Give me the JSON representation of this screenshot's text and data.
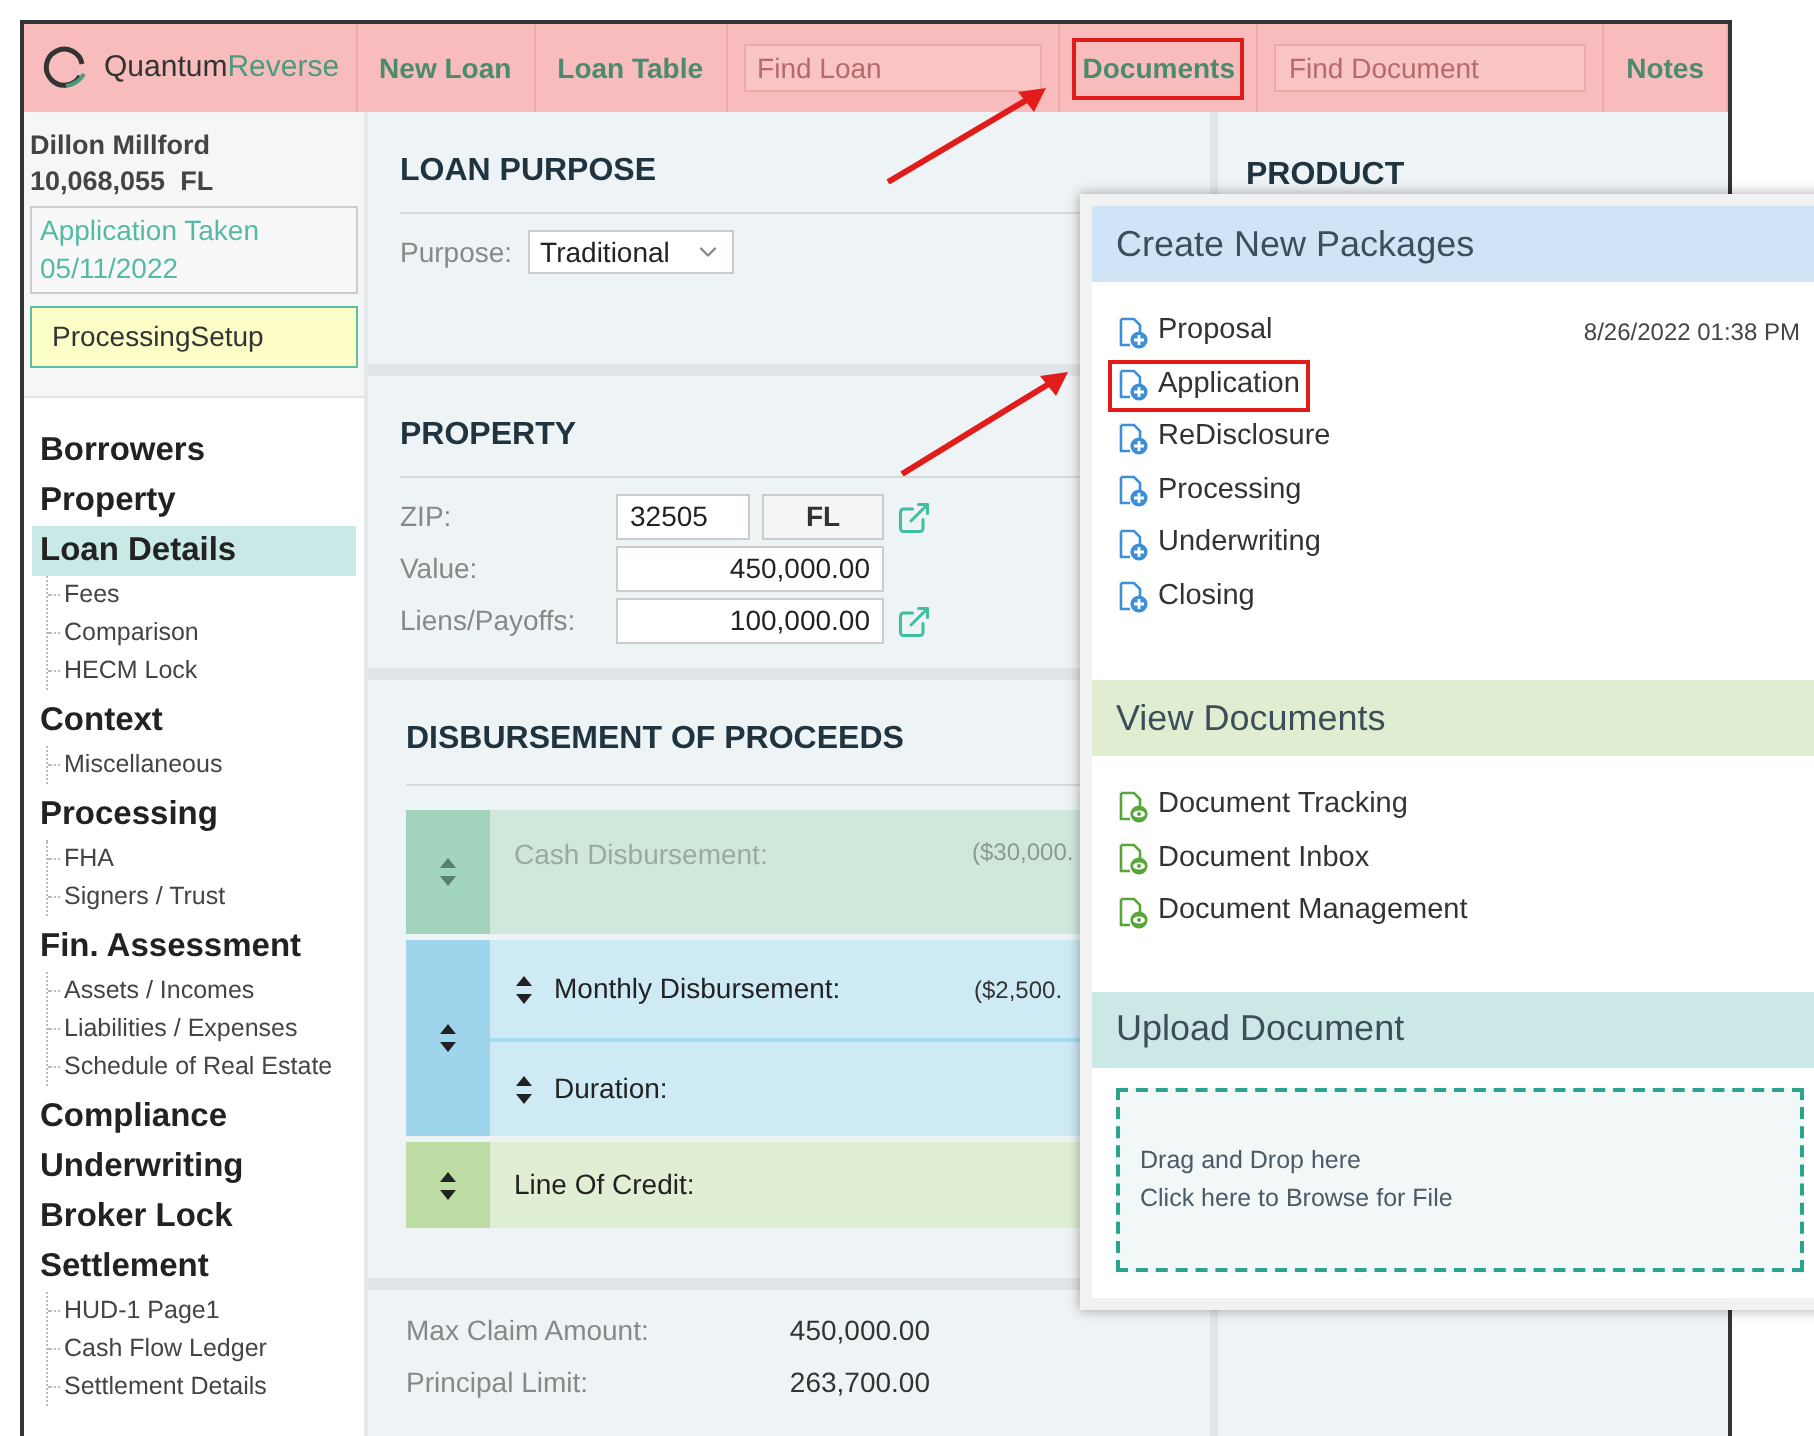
{
  "topbar": {
    "logo": {
      "brand_first": "Quantum",
      "brand_second": "Reverse"
    },
    "items": [
      {
        "kind": "link",
        "label": "New Loan",
        "highlighted": false
      },
      {
        "kind": "link",
        "label": "Loan Table",
        "highlighted": false
      },
      {
        "kind": "search",
        "placeholder": "Find Loan"
      },
      {
        "kind": "link",
        "label": "Documents",
        "highlighted": true
      },
      {
        "kind": "search",
        "placeholder": "Find Document"
      },
      {
        "kind": "link",
        "label": "Notes",
        "highlighted": false
      }
    ]
  },
  "borrower": {
    "name": "Dillon Millford",
    "loan_number": "10,068,055",
    "state": "FL",
    "status": "Application Taken",
    "status_date": "05/11/2022",
    "stage": "ProcessingSetup"
  },
  "nav": [
    {
      "label": "Borrowers",
      "selected": false
    },
    {
      "label": "Property",
      "selected": false
    },
    {
      "label": "Loan Details",
      "selected": true,
      "children": [
        {
          "label": "Fees"
        },
        {
          "label": "Comparison"
        },
        {
          "label": "HECM Lock"
        }
      ]
    },
    {
      "label": "Context",
      "selected": false,
      "children": [
        {
          "label": "Miscellaneous"
        }
      ]
    },
    {
      "label": "Processing",
      "selected": false,
      "children": [
        {
          "label": "FHA"
        },
        {
          "label": "Signers / Trust"
        }
      ]
    },
    {
      "label": "Fin. Assessment",
      "selected": false,
      "children": [
        {
          "label": "Assets / Incomes"
        },
        {
          "label": "Liabilities / Expenses"
        },
        {
          "label": "Schedule of Real Estate"
        }
      ]
    },
    {
      "label": "Compliance",
      "selected": false
    },
    {
      "label": "Underwriting",
      "selected": false
    },
    {
      "label": "Broker Lock",
      "selected": false
    },
    {
      "label": "Settlement",
      "selected": false,
      "children": [
        {
          "label": "HUD-1 Page1"
        },
        {
          "label": "Cash Flow Ledger"
        },
        {
          "label": "Settlement Details"
        }
      ]
    }
  ],
  "loan_purpose": {
    "title": "LOAN PURPOSE",
    "purpose_label": "Purpose:",
    "purpose_value": "Traditional"
  },
  "property": {
    "title": "PROPERTY",
    "zip_label": "ZIP:",
    "zip": "32505",
    "state": "FL",
    "value_label": "Value:",
    "value": "450,000.00",
    "liens_label": "Liens/Payoffs:",
    "liens": "100,000.00"
  },
  "disbursement": {
    "title": "DISBURSEMENT OF PROCEEDS",
    "groups": [
      {
        "kind": "cash",
        "items": [
          {
            "label": "Cash Disbursement:",
            "amount": "($30,000.",
            "disabled": true
          }
        ]
      },
      {
        "kind": "tenure",
        "items": [
          {
            "label": "Monthly Disbursement:",
            "amount": "($2,500.",
            "disabled": false
          },
          {
            "label": "Duration:",
            "disabled": false
          }
        ]
      },
      {
        "kind": "credit",
        "items": [
          {
            "label": "Line Of Credit:",
            "disabled": false
          }
        ]
      }
    ]
  },
  "summary": [
    {
      "label": "Max Claim Amount:",
      "value": "450,000.00"
    },
    {
      "label": "Principal Limit:",
      "value": "263,700.00"
    }
  ],
  "product": {
    "title": "PRODUCT"
  },
  "documents_popup": {
    "sections": [
      {
        "kind": "create",
        "title": "Create New Packages",
        "items": [
          {
            "label": "Proposal",
            "timestamp": "8/26/2022 01:38 PM",
            "highlighted": false
          },
          {
            "label": "Application",
            "highlighted": true
          },
          {
            "label": "ReDisclosure",
            "highlighted": false
          },
          {
            "label": "Processing",
            "highlighted": false
          },
          {
            "label": "Underwriting",
            "highlighted": false
          },
          {
            "label": "Closing",
            "highlighted": false
          }
        ]
      },
      {
        "kind": "view",
        "title": "View Documents",
        "items": [
          {
            "label": "Document Tracking"
          },
          {
            "label": "Document Inbox"
          },
          {
            "label": "Document Management"
          }
        ]
      },
      {
        "kind": "upload",
        "title": "Upload Document",
        "lines": [
          "Drag and Drop here",
          "Click here to Browse for File"
        ]
      }
    ]
  }
}
